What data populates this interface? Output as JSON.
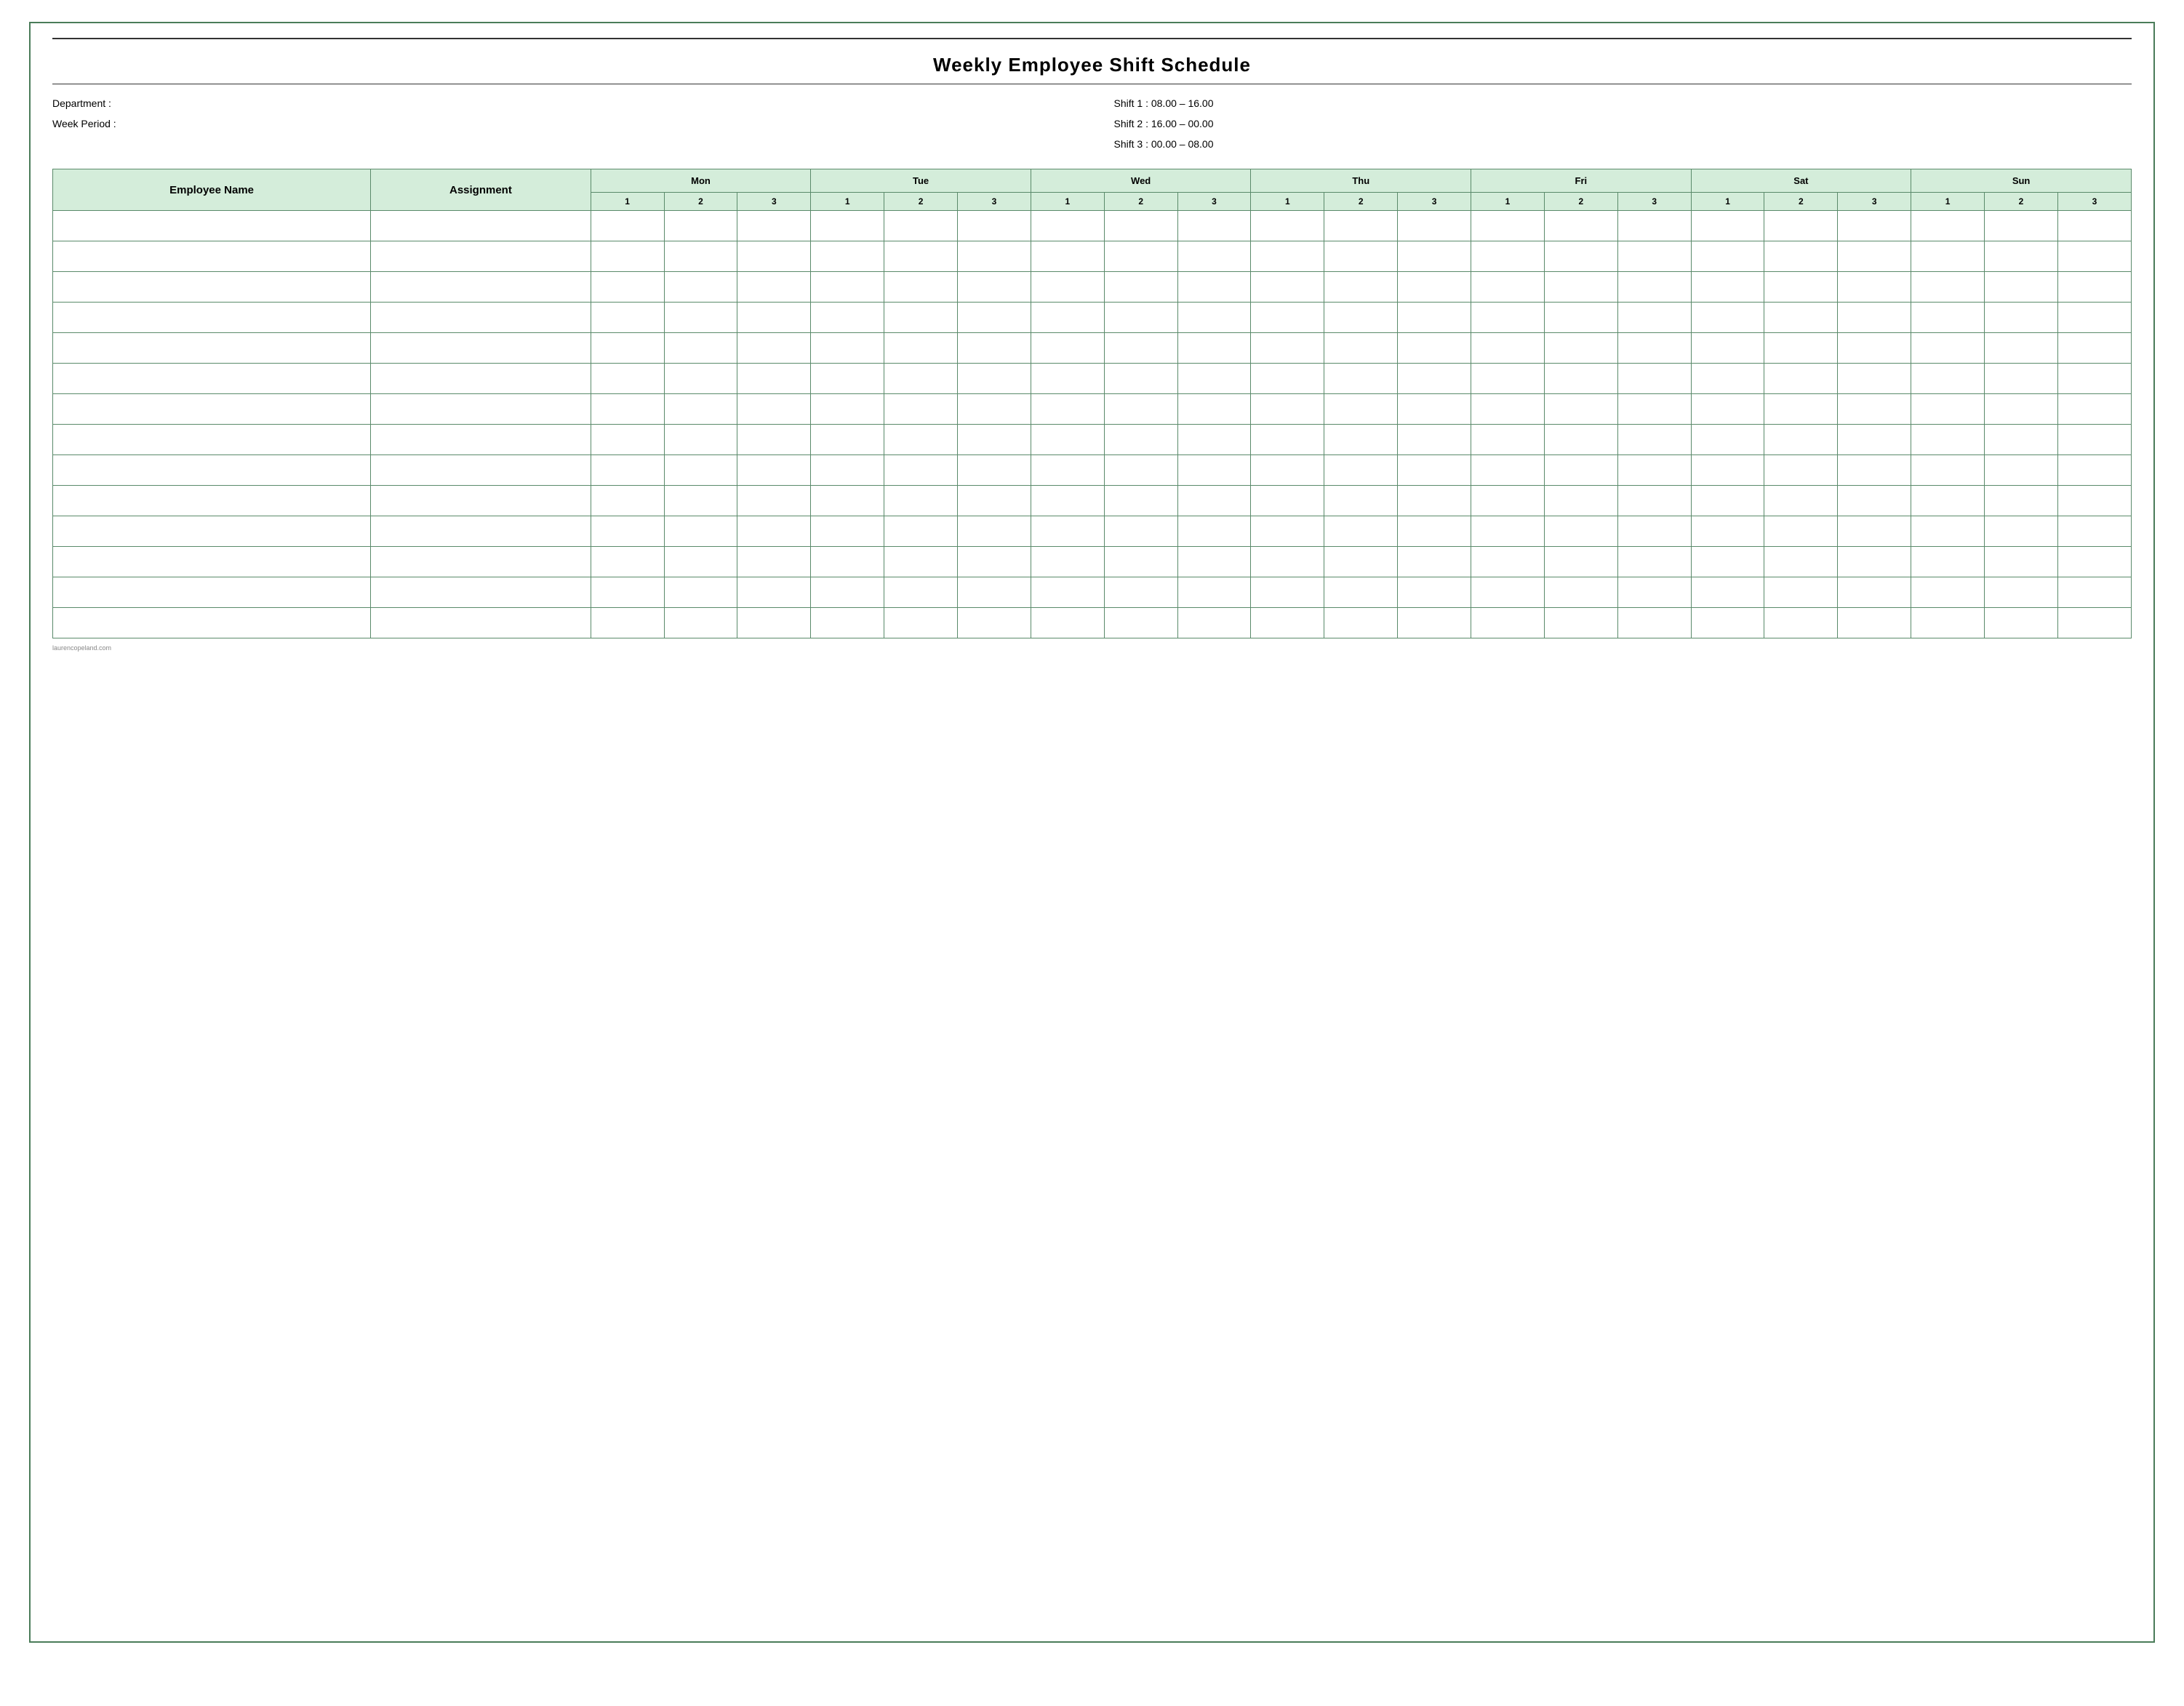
{
  "title": "Weekly Employee Shift Schedule",
  "info": {
    "department_label": "Department  :",
    "week_period_label": "Week Period :",
    "shift1": "Shift 1 : 08.00 – 16.00",
    "shift2": "Shift 2 : 16.00 – 00.00",
    "shift3": "Shift 3 : 00.00 – 08.00"
  },
  "table": {
    "col_employee": "Employee Name",
    "col_assignment": "Assignment",
    "days": [
      "Mon",
      "Tue",
      "Wed",
      "Thu",
      "Fri",
      "Sat",
      "Sun"
    ],
    "shifts": [
      "1",
      "2",
      "3"
    ],
    "num_data_rows": 14
  },
  "footer": "laurencopeland.com"
}
